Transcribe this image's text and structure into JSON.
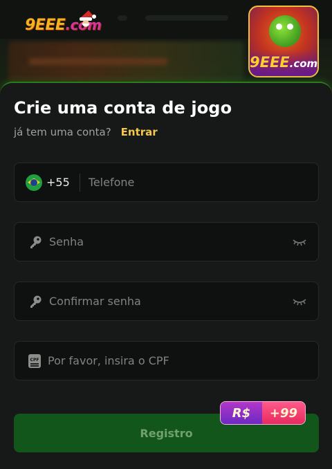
{
  "site": {
    "logo_main": "9EEE",
    "logo_suffix": ".com",
    "app_icon_text": "9EEE",
    "app_icon_suffix": ".com"
  },
  "modal": {
    "title": "Crie uma conta de jogo",
    "subtitle": "já tem uma conta?",
    "login_link": "Entrar"
  },
  "form": {
    "phone": {
      "country_code": "+55",
      "placeholder": "Telefone",
      "flag": "brazil-flag-icon"
    },
    "password": {
      "placeholder": "Senha",
      "icon": "key-icon",
      "toggle_icon": "eye-closed-icon"
    },
    "confirm_password": {
      "placeholder": "Confirmar senha",
      "icon": "key-icon",
      "toggle_icon": "eye-closed-icon"
    },
    "cpf": {
      "placeholder": "Por favor, insira o CPF",
      "icon": "cpf-card-icon",
      "icon_text": "CPF"
    }
  },
  "register": {
    "label": "Registro",
    "bonus_currency": "R$",
    "bonus_amount": "+99"
  },
  "colors": {
    "accent_green": "#13561c",
    "link_yellow": "#f3c64d",
    "modal_bg": "#161917",
    "field_bg": "#0f1110"
  }
}
